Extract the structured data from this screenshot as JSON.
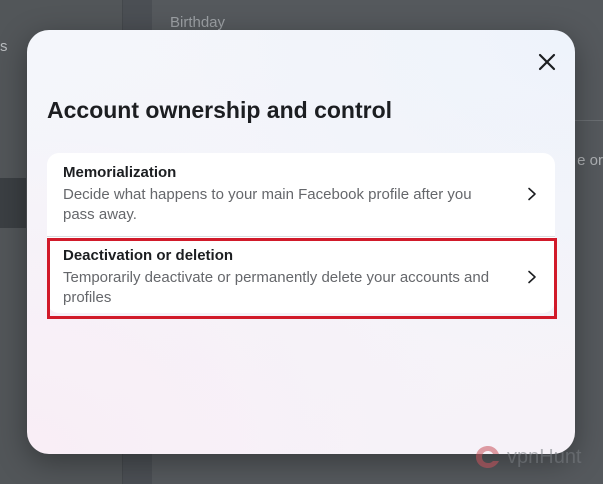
{
  "background": {
    "sidebar_fragment": "s",
    "birthday_label": "Birthday",
    "right_fragment": "e or"
  },
  "modal": {
    "close_icon": "close-icon",
    "title": "Account ownership and control",
    "items": [
      {
        "title": "Memorialization",
        "description": "Decide what happens to your main Facebook profile after you pass away.",
        "icon": "chevron-right-icon"
      },
      {
        "title": "Deactivation or deletion",
        "description": "Temporarily deactivate or permanently delete your accounts and profiles",
        "icon": "chevron-right-icon",
        "highlighted": true
      }
    ]
  },
  "watermark": {
    "text": "vpnHunt",
    "icon": "vpnhunt-logo-icon"
  },
  "colors": {
    "highlight": "#d11a2a",
    "overlay": "#4b4f54",
    "title_text": "#1c1e21",
    "secondary_text": "#65676b"
  }
}
